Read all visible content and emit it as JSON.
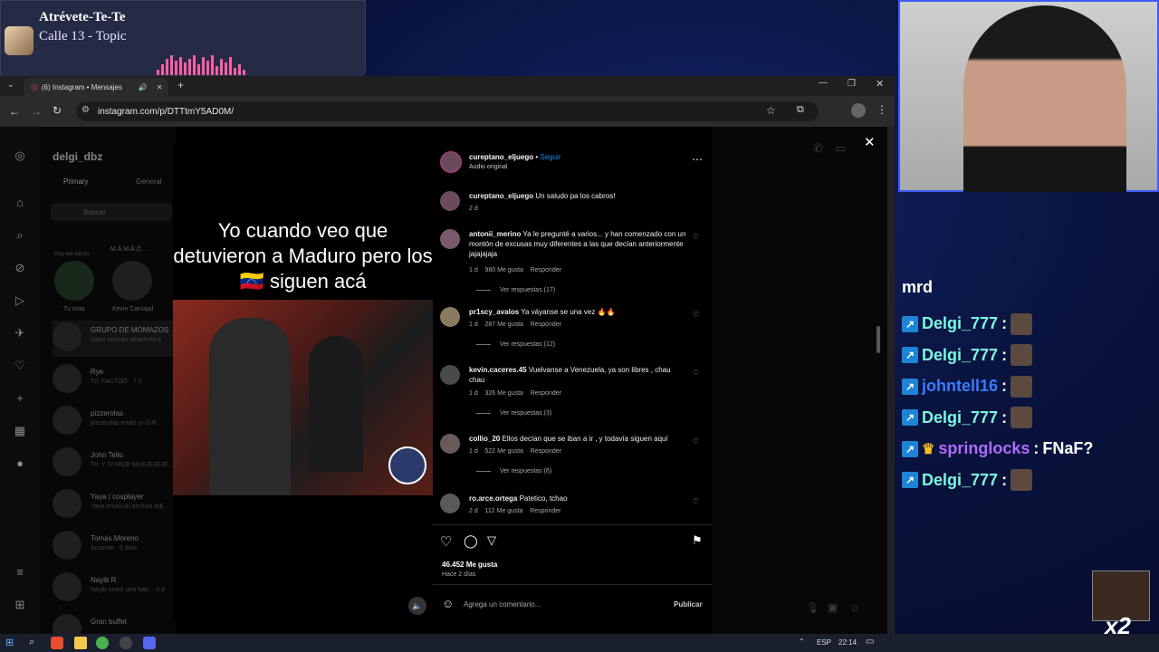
{
  "now_playing": {
    "title": "Atrévete-Te-Te",
    "artist": "Calle 13 - Topic"
  },
  "browser": {
    "tab_title": "(6) Instagram • Mensajes",
    "url": "instagram.com/p/DTTtmY5AD0M/",
    "new_tab": "+"
  },
  "instagram": {
    "account": "delgi_dbz",
    "tabs": [
      "Primary",
      "General"
    ],
    "search_placeholder": "Buscar",
    "note_label": "Tu nota",
    "note_hint": "Hoy me siento",
    "story_user": "Kevin Carvajal",
    "story_group": "M.Á.M.Á (f...",
    "dms": [
      {
        "name": "GRUPO DE MOMAZOS",
        "sub": "Jolvo sent an attachment."
      },
      {
        "name": "Rye",
        "sub": "Tú: FACTOO · 7 h"
      },
      {
        "name": "pizzerolas",
        "sub": "pizzerolas envió un GIF."
      },
      {
        "name": "John Tello",
        "sub": "Tú: Y SI HICE MUEJEJEJE..."
      },
      {
        "name": "Yaya | cosplayer",
        "sub": "Yaya envió un archivo adj..."
      },
      {
        "name": "Tomás Moreno",
        "sub": "Ausente · 3 días"
      },
      {
        "name": "Nayib R",
        "sub": "Nayib envió una foto. · 3 d"
      },
      {
        "name": "Gran buffet",
        "sub": ""
      }
    ]
  },
  "post": {
    "video_caption": "Yo cuando veo que detuvieron a Maduro pero los 🇻🇪 siguen acá",
    "author": "cureptano_eljuego",
    "follow": "Seguir",
    "audio": "Audio original",
    "caption_text": "Un saludo pa los cabros!",
    "caption_time": "2 d",
    "likes": "46.452 Me gusta",
    "date": "Hace 2 días",
    "comment_placeholder": "Agrega un comentario...",
    "publish": "Publicar",
    "comments": [
      {
        "user": "antonii_merino",
        "text": "Ya le pregunté a varios... y han comenzado con un montón de excusas muy diferentes a las que decían anteriormente jajajajaja",
        "time": "1 d",
        "likes": "980 Me gusta",
        "reply": "Responder",
        "replies": "Ver respuestas (17)"
      },
      {
        "user": "pr1scy_avalos",
        "text": "Ya váyanse se una vez 🔥🔥",
        "time": "1 d",
        "likes": "287 Me gusta",
        "reply": "Responder",
        "replies": "Ver respuestas (12)"
      },
      {
        "user": "kevin.caceres.45",
        "text": "Vuelvanse a Venezuela, ya son libres , chau chau",
        "time": "1 d",
        "likes": "326 Me gusta",
        "reply": "Responder",
        "replies": "Ver respuestas (3)"
      },
      {
        "user": "collio_20",
        "text": "Ellos decían que se iban a ir , y todavía siguen aquí",
        "time": "1 d",
        "likes": "522 Me gusta",
        "reply": "Responder",
        "replies": "Ver respuestas (6)"
      },
      {
        "user": "ro.arce.ortega",
        "text": "Patetico, tchao",
        "time": "2 d",
        "likes": "112 Me gusta",
        "reply": "Responder",
        "replies": ""
      }
    ]
  },
  "chat": {
    "partial": "mrd",
    "lines": [
      {
        "user": "Delgi_777",
        "color": "#7cf5e0",
        "sep": ":",
        "msg": ""
      },
      {
        "user": "Delgi_777",
        "color": "#7cf5e0",
        "sep": ":",
        "msg": ""
      },
      {
        "user": "johntell16",
        "color": "#3a7bff",
        "sep": ":",
        "msg": ""
      },
      {
        "user": "Delgi_777",
        "color": "#7cf5e0",
        "sep": ":",
        "msg": ""
      },
      {
        "user": "springlocks",
        "color": "#b06cff",
        "sep": ":",
        "msg": "FNaF?"
      },
      {
        "user": "Delgi_777",
        "color": "#7cf5e0",
        "sep": ":",
        "msg": ""
      }
    ],
    "multiplier": "x2"
  },
  "taskbar": {
    "lang": "ESP",
    "time": "22:14"
  },
  "colors": {
    "accent_blue": "#0095f6",
    "cam_border": "#3b5cff"
  }
}
